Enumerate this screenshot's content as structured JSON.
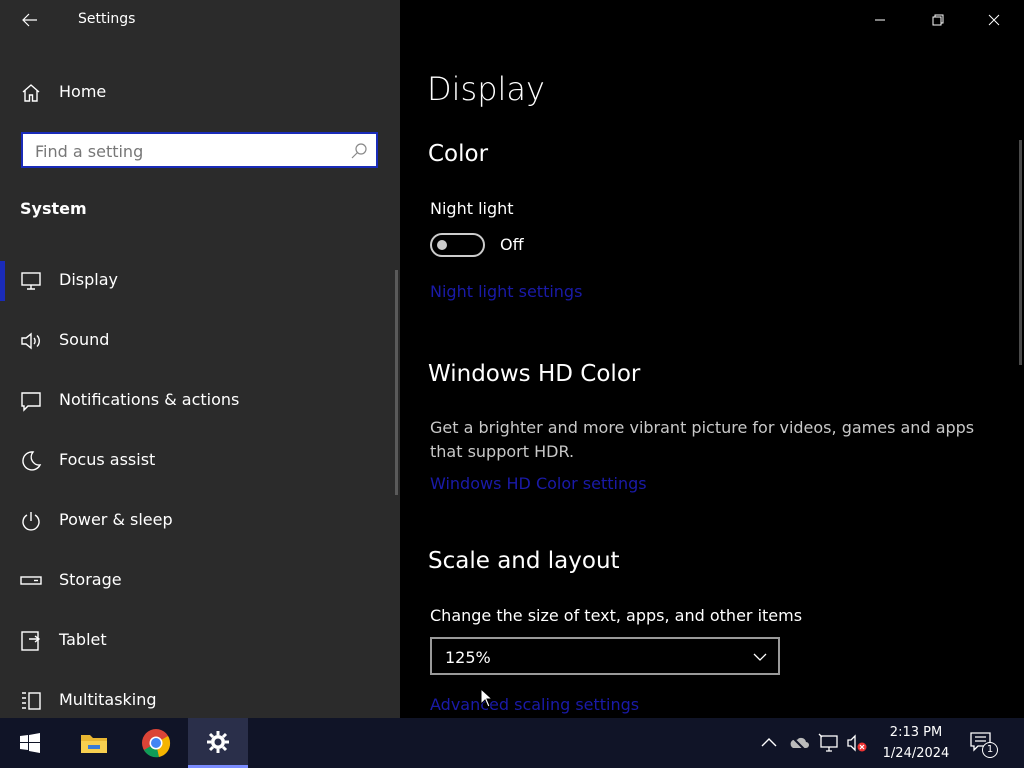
{
  "window": {
    "title": "Settings",
    "controls": {
      "minimize": "minimize",
      "maximize": "restore",
      "close": "close"
    }
  },
  "sidebar": {
    "home_label": "Home",
    "search": {
      "placeholder": "Find a setting",
      "value": ""
    },
    "section": "System",
    "items": [
      {
        "label": "Display",
        "icon": "monitor-icon",
        "selected": true
      },
      {
        "label": "Sound",
        "icon": "speaker-icon"
      },
      {
        "label": "Notifications & actions",
        "icon": "notification-icon"
      },
      {
        "label": "Focus assist",
        "icon": "moon-icon"
      },
      {
        "label": "Power & sleep",
        "icon": "power-icon"
      },
      {
        "label": "Storage",
        "icon": "storage-icon"
      },
      {
        "label": "Tablet",
        "icon": "tablet-icon"
      },
      {
        "label": "Multitasking",
        "icon": "multitasking-icon"
      }
    ]
  },
  "main": {
    "title": "Display",
    "color": {
      "heading": "Color",
      "night_light_label": "Night light",
      "night_light_state": "Off",
      "night_light_link": "Night light settings"
    },
    "hdr": {
      "heading": "Windows HD Color",
      "description": "Get a brighter and more vibrant picture for videos, games and apps that support HDR.",
      "link": "Windows HD Color settings"
    },
    "scale": {
      "heading": "Scale and layout",
      "label": "Change the size of text, apps, and other items",
      "value": "125%",
      "link": "Advanced scaling settings"
    }
  },
  "taskbar": {
    "pinned": [
      "windows-start-icon",
      "file-explorer-icon",
      "chrome-icon",
      "settings-icon"
    ],
    "active": "settings-icon",
    "time": "2:13 PM",
    "date": "1/24/2024",
    "notification_count": "1"
  },
  "colors": {
    "accent": "#1a2bb8",
    "link": "#1a1aa8",
    "sidebar_bg": "#2b2b2b",
    "content_bg": "#000000"
  }
}
